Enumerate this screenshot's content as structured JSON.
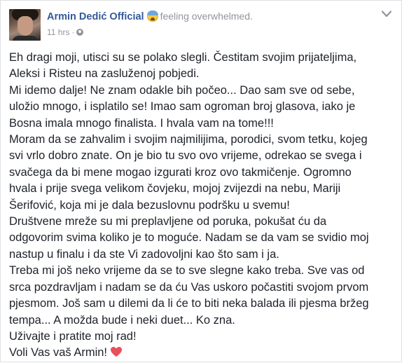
{
  "post": {
    "author": "Armin Dedić Official",
    "feeling": "feeling overwhelmed.",
    "emoji_icon": "overwhelmed-face-icon",
    "time": "11 hrs",
    "separator": "·",
    "privacy_icon": "globe-icon",
    "menu_icon": "chevron-down-icon",
    "lines": [
      "Eh dragi moji, utisci su se polako slegli. Čestitam svojim prijateljima,",
      "Aleksi i Risteu na zasluženoj pobjedi.",
      "Mi idemo dalje! Ne znam odakle bih počeo... Dao sam sve od sebe,",
      "uložio mnogo, i isplatilo se! Imao sam ogroman broj glasova, iako je",
      "Bosna imala mnogo finalista. I hvala vam na tome!!!",
      "Moram da se zahvalim i svojim najmilijima, porodici, svom tetku, kojeg",
      "svi vrlo dobro znate. On je bio tu svo ovo vrijeme, odrekao se svega i",
      "svačega da bi mene mogao izgurati kroz ovo takmičenje. Ogromno",
      "hvala i prije svega velikom čovjeku, mojoj zvijezdi na nebu, Mariji",
      "Šerifović, koja mi je dala bezuslovnu podršku u svemu!",
      "Društvene mreže su mi preplavljene od poruka, pokušat ću da",
      "odgovorim svima koliko je to moguće. Nadam se da vam se svidio moj",
      "nastup u finalu i da ste Vi zadovoljni kao što sam i ja.",
      "Treba mi još neko vrijeme da se to sve slegne kako treba. Sve vas od",
      "srca pozdravljam i nadam se da ću Vas uskoro počastiti svojom prvom",
      "pjesmom. Još sam u dilemi da li će to biti neka balada ili pjesma bržeg",
      "tempa... A možda bude i neki duet... Ko zna.",
      "Uživajte i pratite moj rad!",
      "Voli Vas vaš Armin!"
    ],
    "heart_icon": "red-heart-icon",
    "colors": {
      "author": "#365899",
      "meta": "#90949c",
      "text": "#1d2129",
      "heart": "#e8505b"
    }
  }
}
